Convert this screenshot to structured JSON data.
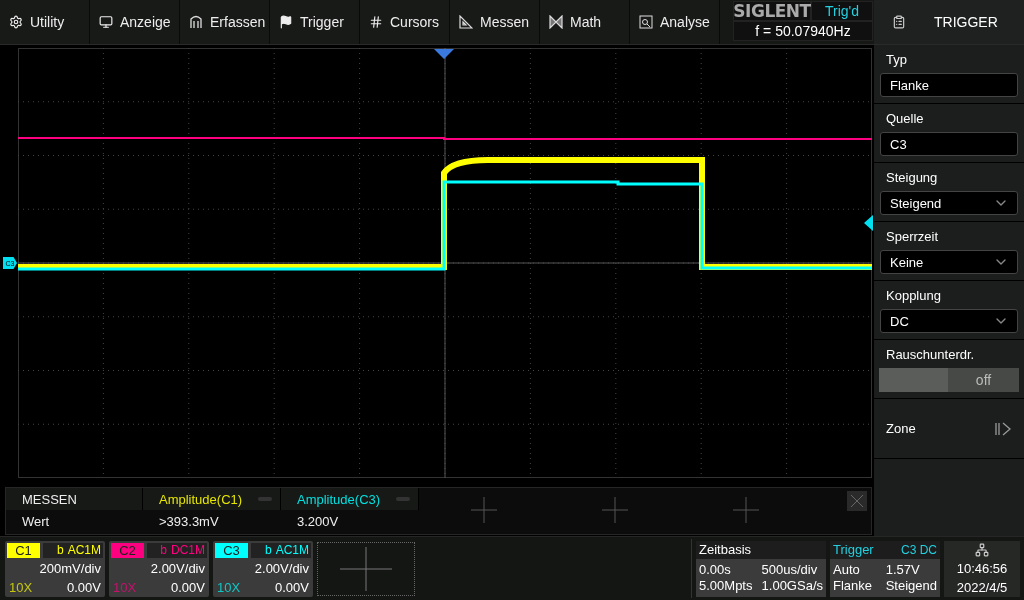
{
  "menu": [
    {
      "label": "Utility"
    },
    {
      "label": "Anzeige"
    },
    {
      "label": "Erfassen"
    },
    {
      "label": "Trigger"
    },
    {
      "label": "Cursors"
    },
    {
      "label": "Messen"
    },
    {
      "label": "Math"
    },
    {
      "label": "Analyse"
    }
  ],
  "status": {
    "brand": "SIGLENT",
    "trigger_state": "Trig'd",
    "frequency": "f = 50.07940Hz"
  },
  "plot": {
    "offset_marker": "C3"
  },
  "measure": {
    "title": "MESSEN",
    "row_label": "Wert",
    "columns": [
      {
        "name": "Amplitude(C1)",
        "value": ">393.3mV",
        "color": "#e6e600"
      },
      {
        "name": "Amplitude(C3)",
        "value": "3.200V",
        "color": "#00e0e0"
      }
    ]
  },
  "channels": [
    {
      "label": "C1",
      "color": "#ffff00",
      "bw": "b",
      "coupling": "AC1M",
      "scale": "200mV/div",
      "probe": "10X",
      "offset": "0.00V"
    },
    {
      "label": "C2",
      "color": "#ff0080",
      "bw": "b",
      "coupling": "DC1M",
      "scale": "2.00V/div",
      "probe": "10X",
      "offset": "0.00V"
    },
    {
      "label": "C3",
      "color": "#00ffff",
      "bw": "b",
      "coupling": "AC1M",
      "scale": "2.00V/div",
      "probe": "10X",
      "offset": "0.00V"
    }
  ],
  "timebase": {
    "title": "Zeitbasis",
    "delay": "0.00s",
    "scale": "500us/div",
    "memory": "5.00Mpts",
    "sample_rate": "1.00GSa/s"
  },
  "trigger_info": {
    "title": "Trigger",
    "source": "C3 DC",
    "mode": "Auto",
    "level": "1.57V",
    "type": "Flanke",
    "slope": "Steigend"
  },
  "clock": {
    "time": "10:46:56",
    "date": "2022/4/5"
  },
  "side_panel": {
    "title": "TRIGGER",
    "items": [
      {
        "kind": "field",
        "label": "Typ",
        "value": "Flanke"
      },
      {
        "kind": "field",
        "label": "Quelle",
        "value": "C3"
      },
      {
        "kind": "dropdown",
        "label": "Steigung",
        "value": "Steigend"
      },
      {
        "kind": "dropdown",
        "label": "Sperrzeit",
        "value": "Keine"
      },
      {
        "kind": "dropdown",
        "label": "Kopplung",
        "value": "DC"
      },
      {
        "kind": "toggle",
        "label": "Rauschunterdr.",
        "value": "off",
        "on": false
      },
      {
        "kind": "link",
        "label": "Zone"
      }
    ]
  }
}
